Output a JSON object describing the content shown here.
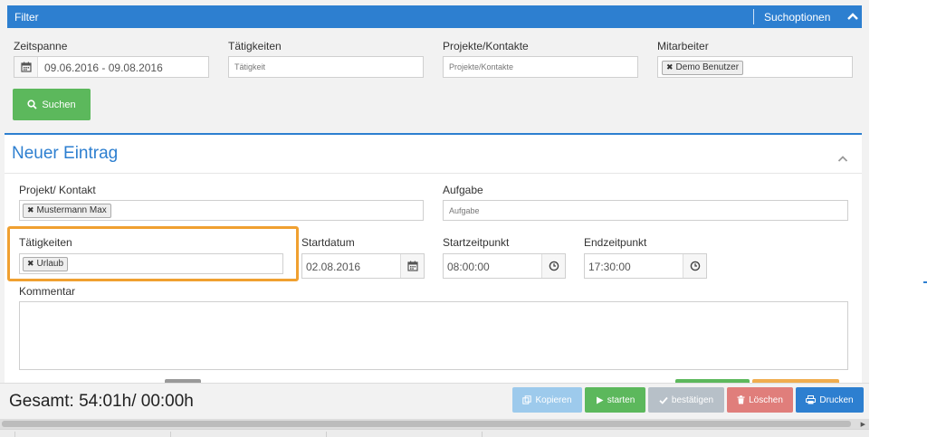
{
  "filter": {
    "title": "Filter",
    "options_label": "Suchoptionen",
    "zeitspanne_label": "Zeitspanne",
    "zeitspanne_value": "09.06.2016 - 09.08.2016",
    "taetigkeiten_label": "Tätigkeiten",
    "taetigkeiten_placeholder": "Tätigkeit",
    "projekte_label": "Projekte/Kontakte",
    "projekte_placeholder": "Projekte/Kontakte",
    "mitarbeiter_label": "Mitarbeiter",
    "mitarbeiter_tag": "Demo Benutzer",
    "search_button": "Suchen"
  },
  "entry": {
    "title": "Neuer Eintrag",
    "projekt_label": "Projekt/ Kontakt",
    "projekt_tag": "Mustermann Max",
    "aufgabe_label": "Aufgabe",
    "aufgabe_placeholder": "Aufgabe",
    "taetigkeiten_label": "Tätigkeiten",
    "taetigkeiten_tag": "Urlaub",
    "startdatum_label": "Startdatum",
    "startdatum_value": "02.08.2016",
    "startzeit_label": "Startzeitpunkt",
    "startzeit_value": "08:00:00",
    "endzeit_label": "Endzeitpunkt",
    "endzeit_value": "17:30:00",
    "kommentar_label": "Kommentar"
  },
  "footer": {
    "total": "Gesamt: 54:01h/ 00:00h",
    "buttons": {
      "kopieren": "Kopieren",
      "starten": "starten",
      "bestaetigen": "bestätigen",
      "loeschen": "Löschen",
      "drucken": "Drucken"
    }
  },
  "colors": {
    "primary": "#2d7fd0",
    "success": "#5cb85c",
    "danger": "#d9534f",
    "highlight": "#f0a030"
  }
}
